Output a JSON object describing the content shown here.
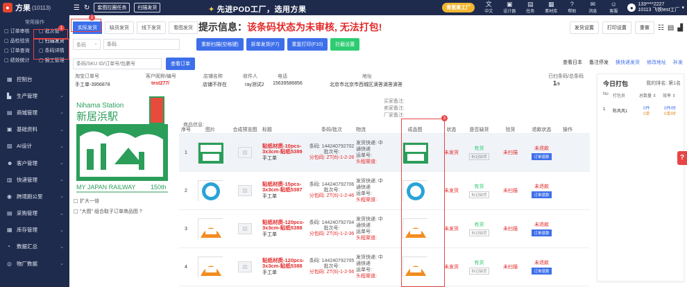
{
  "app": {
    "name": "方果",
    "account_id": "(10113)"
  },
  "topbar": {
    "btn_pick": "套图拉圈任务",
    "btn_scan": "扫描发货",
    "slogan": "先进POD工厂，选用方果",
    "promo": "青葱果工厂",
    "menus": [
      {
        "icon": "文",
        "label": "中文"
      },
      {
        "icon": "▣",
        "label": "设计器"
      },
      {
        "icon": "▤",
        "label": "任务"
      },
      {
        "icon": "▦",
        "label": "素材库"
      },
      {
        "icon": "?",
        "label": "帮助"
      },
      {
        "icon": "✉",
        "label": "消息"
      },
      {
        "icon": "☺",
        "label": "客服"
      }
    ],
    "user_phone": "133****2227",
    "user_name": "10113 飞铁test工厂"
  },
  "sidebar": {
    "common_title": "常用操作",
    "quick": [
      {
        "icon": "▢",
        "label": "订单审核"
      },
      {
        "icon": "▢",
        "label": "批次管"
      },
      {
        "icon": "▢",
        "label": "品检验货"
      },
      {
        "icon": "▢",
        "label": "扫描发货"
      },
      {
        "icon": "▢",
        "label": "订单查询"
      },
      {
        "icon": "▢",
        "label": "条码详情"
      },
      {
        "icon": "▢",
        "label": "绩效统计"
      },
      {
        "icon": "▢",
        "label": "报工管理"
      }
    ],
    "menu": [
      {
        "icon": "▦",
        "label": "控制台",
        "chev": ""
      },
      {
        "icon": "▙",
        "label": "生产管理",
        "chev": "⌄"
      },
      {
        "icon": "▤",
        "label": "商城管理",
        "chev": "⌄"
      },
      {
        "icon": "▣",
        "label": "基础资料",
        "chev": "⌄"
      },
      {
        "icon": "▨",
        "label": "AI设计",
        "chev": "⌄"
      },
      {
        "icon": "☻",
        "label": "客户管理",
        "chev": "⌄"
      },
      {
        "icon": "▥",
        "label": "快递管理",
        "chev": "⌄"
      },
      {
        "icon": "◉",
        "label": "跨境跑公里",
        "chev": "⌄"
      },
      {
        "icon": "▤",
        "label": "采购管理",
        "chev": "⌄"
      },
      {
        "icon": "▦",
        "label": "库存管理",
        "chev": "⌄"
      },
      {
        "icon": "◔",
        "label": "数据汇总",
        "chev": "⌄"
      },
      {
        "icon": "◎",
        "label": "物厂数据",
        "chev": "⌄"
      }
    ]
  },
  "badges": {
    "b1": "1",
    "b2": "2",
    "b3": "3"
  },
  "main": {
    "tabs": [
      "实际发货",
      "缺货发货",
      "线下发货",
      "看图发货"
    ],
    "notice_label": "提示信息：",
    "notice_msg": "该条码状态为未审核, 无法打包!",
    "right_buttons": [
      "发货设置",
      "打印设置",
      "重做"
    ],
    "scan_select": "条码",
    "scan_placeholder": "条码",
    "scan_buttons": [
      "重新扫描(空格键)",
      "拆单发货(F7)",
      "重复打印(F10)",
      "拦截设置"
    ],
    "search_placeholder": "条码/SKU ID/订单号/包裹号",
    "search_button": "查看订单",
    "right_links": [
      {
        "text": "查看日本",
        "link": false
      },
      {
        "text": "备注停发",
        "link": false
      },
      {
        "text": "换快递发货",
        "link": true
      },
      {
        "text": "修改地址",
        "link": true
      },
      {
        "text": "补发",
        "link": true
      }
    ],
    "info_headers": [
      "淘宝订单号",
      "客户昵称/编号",
      "店铺名称",
      "收件人",
      "电话",
      "地址"
    ],
    "info_values": [
      "手工单-3956878",
      "test277/",
      "店铺不存在",
      "ray测试2",
      "15639586856",
      "北京市北京市西城区滴答滴答滴答"
    ],
    "total_label": "已扫条码/总条码",
    "total_value": "1",
    "total_of": "/6",
    "detail_label": "商品信息:",
    "remarks": [
      "买家备注:",
      "卖家备注:",
      "厂家备注:"
    ],
    "preview_options": [
      "扩大一倍",
      "\"大图\" 组合取子订单商品图 ?"
    ]
  },
  "table": {
    "headers": [
      "序号",
      "图片",
      "合成预览图",
      "标题",
      "条码/批次",
      "物流",
      "成品图",
      "状态",
      "是否缺货",
      "验货",
      "退款状态",
      "操作"
    ],
    "rows": [
      {
        "no": "1",
        "title": "贴纸材质-10pcs-3x3cm-贴纸5389",
        "title_sub": "手工单",
        "barcode": "条码: 144240792702",
        "batch": "批次号:",
        "split": "分包码: ZT(6)-1-2-26",
        "logi": "发货快递: 中通快递",
        "waybill": "运单号:",
        "head": "头程渠道:",
        "status": "未发货",
        "stock": "有货",
        "stock_tag": "标记缺货",
        "check": "未扫描",
        "refund": "未退款",
        "refund_tag": "订单退款",
        "hl": true
      },
      {
        "no": "2",
        "title": "贴纸材质-15pcs-3x3cm-贴纸5387",
        "title_sub": "手工单",
        "barcode": "条码: 144240792706",
        "batch": "批次号:",
        "split": "分包码: ZT(6)-1-2-46",
        "logi": "发货快递: 中通快递",
        "waybill": "运单号:",
        "head": "头程渠道:",
        "status": "未发货",
        "stock": "有货",
        "stock_tag": "标记缺货",
        "check": "未扫描",
        "refund": "未退款",
        "refund_tag": "订单退款",
        "hl": false
      },
      {
        "no": "3",
        "title": "贴纸材质-120pcs-3x3cm-贴纸5388",
        "title_sub": "手工单",
        "barcode": "条码: 144240792704",
        "batch": "批次号:",
        "split": "分包码: ZT(6)-1-2-36",
        "logi": "发货快递: 中通快递",
        "waybill": "运单号:",
        "head": "头程渠道:",
        "status": "未发货",
        "stock": "有货",
        "stock_tag": "标记缺货",
        "check": "未扫描",
        "refund": "未退款",
        "refund_tag": "订单退款",
        "hl": false
      },
      {
        "no": "4",
        "title": "贴纸材质-120pcs-3x3cm-贴纸5388",
        "title_sub": "手工单",
        "barcode": "条码: 144240792705",
        "batch": "批次号:",
        "split": "分包码: ZT(6)-1-2-56",
        "logi": "发货快递: 中通快递",
        "waybill": "运单号:",
        "head": "头程渠道:",
        "status": "未发货",
        "stock": "有货",
        "stock_tag": "标记缺货",
        "check": "未扫描",
        "refund": "未退款",
        "refund_tag": "订单退款",
        "hl": false
      }
    ],
    "last_barcode": "条码: 14424079270"
  },
  "today": {
    "title": "今日打包",
    "rank": "我的排名: 第1名",
    "headers": [
      "No",
      "打包员",
      "总数量 ⇕",
      "效率 ⇕"
    ],
    "row": {
      "no": "1",
      "name": "陈风风1",
      "total_a": "0件",
      "total_b": "0单",
      "eff_a": "0件/时",
      "eff_b": "0单/时"
    }
  },
  "stamp": {
    "line1": "Nihama Station",
    "line2": "新居浜駅",
    "line3": "MY JAPAN RAILWAY",
    "line4": "150th"
  },
  "colors": {
    "accent": "#3d6fea",
    "nav": "#1f2b4d",
    "alert": "#e32929",
    "ok": "#2ecc71"
  }
}
